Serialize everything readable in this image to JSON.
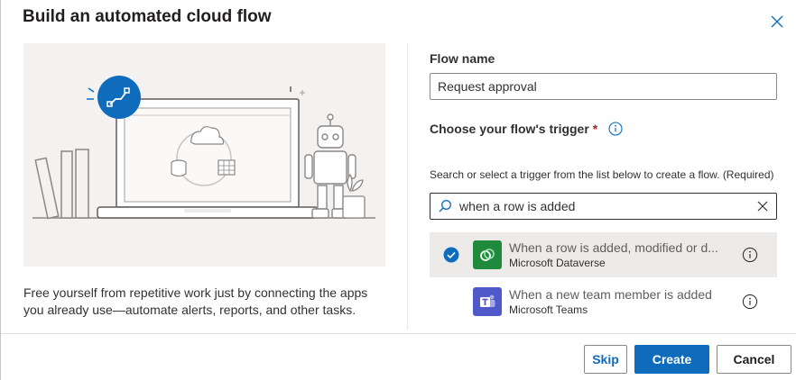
{
  "dialog": {
    "title": "Build an automated cloud flow",
    "close_icon": "close-icon"
  },
  "illustration": {
    "description": "Free yourself from repetitive work just by connecting the apps you already use—automate alerts, reports, and other tasks."
  },
  "form": {
    "flow_name_label": "Flow name",
    "flow_name_value": "Request approval",
    "trigger_label": "Choose your flow's trigger",
    "required_marker": "*",
    "help_text": "Search or select a trigger from the list below to create a flow. (Required)",
    "search_value": "when a row is added",
    "search_icon": "search-icon",
    "clear_icon": "close-icon"
  },
  "triggers": [
    {
      "title": "When a row is added, modified or d...",
      "connector": "Microsoft Dataverse",
      "selected": true,
      "color": "#1f8a3c"
    },
    {
      "title": "When a new team member is added",
      "connector": "Microsoft Teams",
      "selected": false,
      "color": "#5059c9"
    }
  ],
  "buttons": {
    "skip": "Skip",
    "create": "Create",
    "cancel": "Cancel"
  },
  "colors": {
    "accent": "#0f6cbd",
    "required": "#a4262c"
  }
}
